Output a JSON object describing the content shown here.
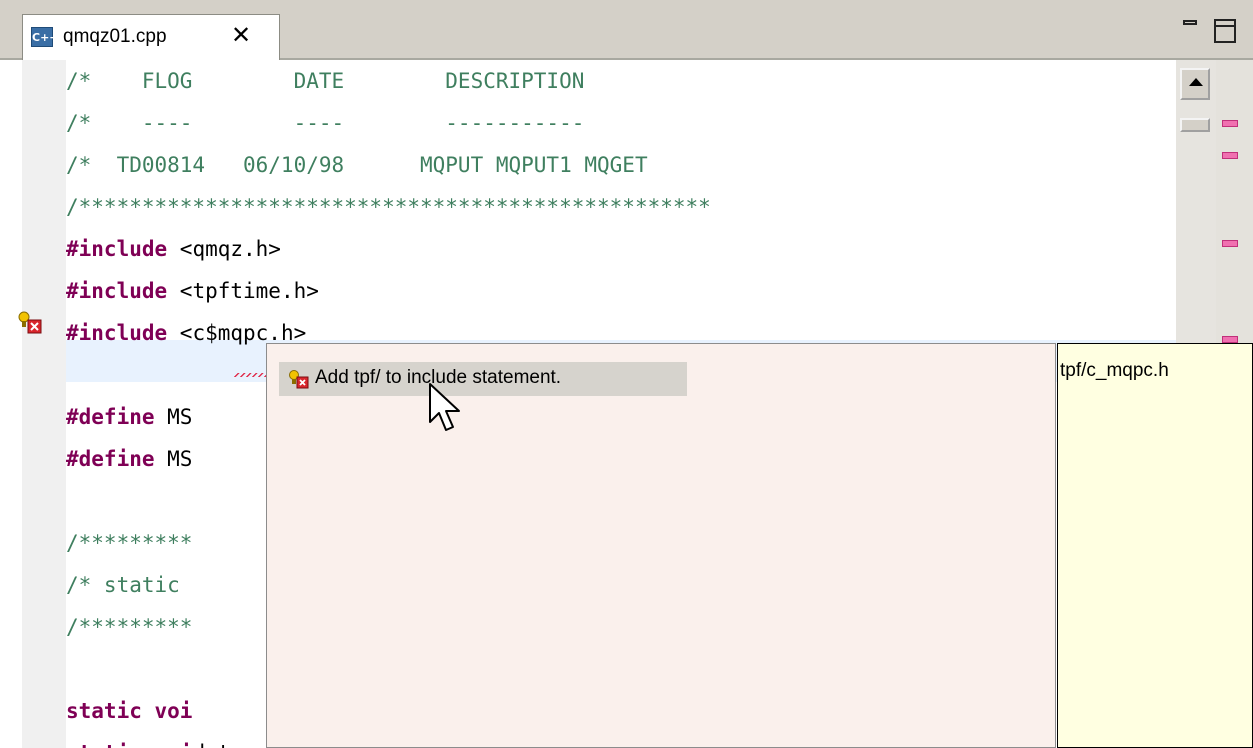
{
  "tab": {
    "icon_text": "C++",
    "filename": "qmqz01.cpp",
    "close_glyph": "✕"
  },
  "editor": {
    "lines": [
      {
        "segments": [
          {
            "text": "/*    FLOG        DATE        DESCRIPTION",
            "cls": "cmt"
          }
        ]
      },
      {
        "segments": [
          {
            "text": "/*    ----        ----        -----------",
            "cls": "cmt"
          }
        ]
      },
      {
        "segments": [
          {
            "text": "/*  TD00814   06/10/98      MQPUT MQPUT1 MQGET",
            "cls": "cmt"
          }
        ]
      },
      {
        "segments": [
          {
            "text": "/**************************************************",
            "cls": "cmt"
          }
        ]
      },
      {
        "segments": [
          {
            "text": "#include",
            "cls": "kw"
          },
          {
            "text": " <qmqz.h>",
            "cls": ""
          }
        ]
      },
      {
        "segments": [
          {
            "text": "#include",
            "cls": "kw"
          },
          {
            "text": " <tpftime.h>",
            "cls": ""
          }
        ]
      },
      {
        "segments": [
          {
            "text": "#include",
            "cls": "kw"
          },
          {
            "text": " <c$mqpc.h>",
            "cls": ""
          }
        ]
      },
      {
        "segments": [
          {
            "text": "",
            "cls": ""
          }
        ]
      },
      {
        "segments": [
          {
            "text": "#define",
            "cls": "kw"
          },
          {
            "text": " MS",
            "cls": ""
          }
        ]
      },
      {
        "segments": [
          {
            "text": "#define",
            "cls": "kw"
          },
          {
            "text": " MS",
            "cls": ""
          }
        ]
      },
      {
        "segments": [
          {
            "text": "",
            "cls": ""
          }
        ]
      },
      {
        "segments": [
          {
            "text": "/*********",
            "cls": "cmt"
          }
        ]
      },
      {
        "segments": [
          {
            "text": "/* static",
            "cls": "cmt"
          }
        ]
      },
      {
        "segments": [
          {
            "text": "/*********",
            "cls": "cmt"
          }
        ]
      },
      {
        "segments": [
          {
            "text": "",
            "cls": ""
          }
        ]
      },
      {
        "segments": [
          {
            "text": "static voi",
            "cls": "kw"
          }
        ]
      },
      {
        "segments": [
          {
            "text": "static voi",
            "cls": "kw"
          },
          {
            "text": "d tmqz_pul_tiuuu  ctuuuv buutean pul_t",
            "cls": ""
          }
        ]
      }
    ]
  },
  "quickfix": {
    "proposal": "Add tpf/ to include statement.",
    "info": "tpf/c_mqpc.h"
  },
  "colors": {
    "keyword": "#7f0055",
    "comment": "#3f7f5f",
    "current_line": "#e8f2fe",
    "error_marker": "#f070b0",
    "popup_bg": "#faf0ec",
    "info_bg": "#ffffe1"
  }
}
